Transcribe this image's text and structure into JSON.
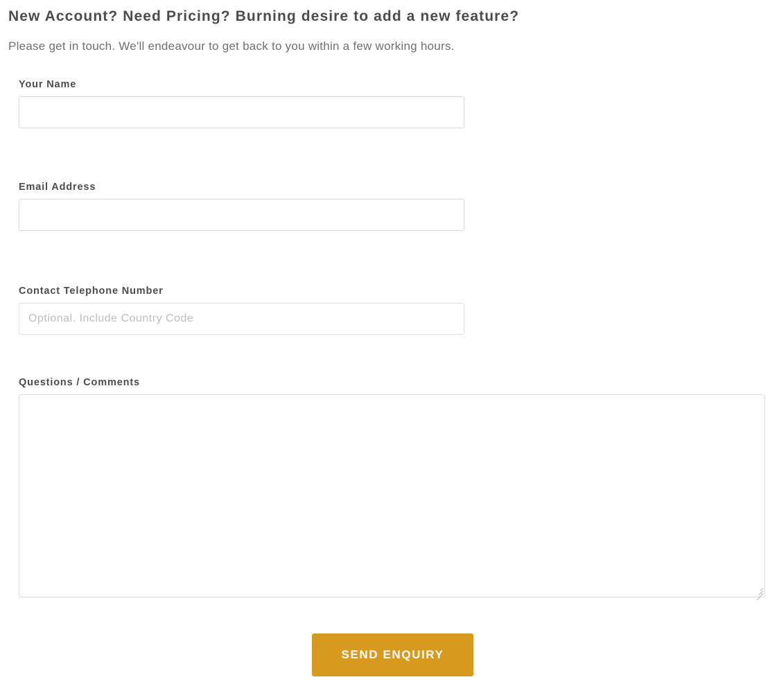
{
  "header": {
    "heading": "New Account? Need Pricing? Burning desire to add a new feature?",
    "subheading": "Please get in touch. We'll endeavour to get back to you within a few working hours."
  },
  "form": {
    "fields": [
      {
        "label": "Your Name",
        "value": "",
        "placeholder": "",
        "type": "text"
      },
      {
        "label": "Email Address",
        "value": "",
        "placeholder": "",
        "type": "email"
      },
      {
        "label": "Contact Telephone Number",
        "value": "",
        "placeholder": "Optional. Include Country Code",
        "type": "tel"
      },
      {
        "label": "Questions / Comments",
        "value": "",
        "placeholder": "",
        "type": "textarea"
      }
    ],
    "submit_label": "Send Enquiry",
    "resize_handle_icon": "resize-grip-icon"
  },
  "colors": {
    "heading_text": "#4c4c4c",
    "body_text": "#6f6f6f",
    "label_text": "#4c4c4c",
    "input_border": "#dcdcdc",
    "placeholder_text": "#bdbdbd",
    "button_background": "#d89a1e",
    "button_text": "#ffffff",
    "page_background": "#ffffff"
  }
}
